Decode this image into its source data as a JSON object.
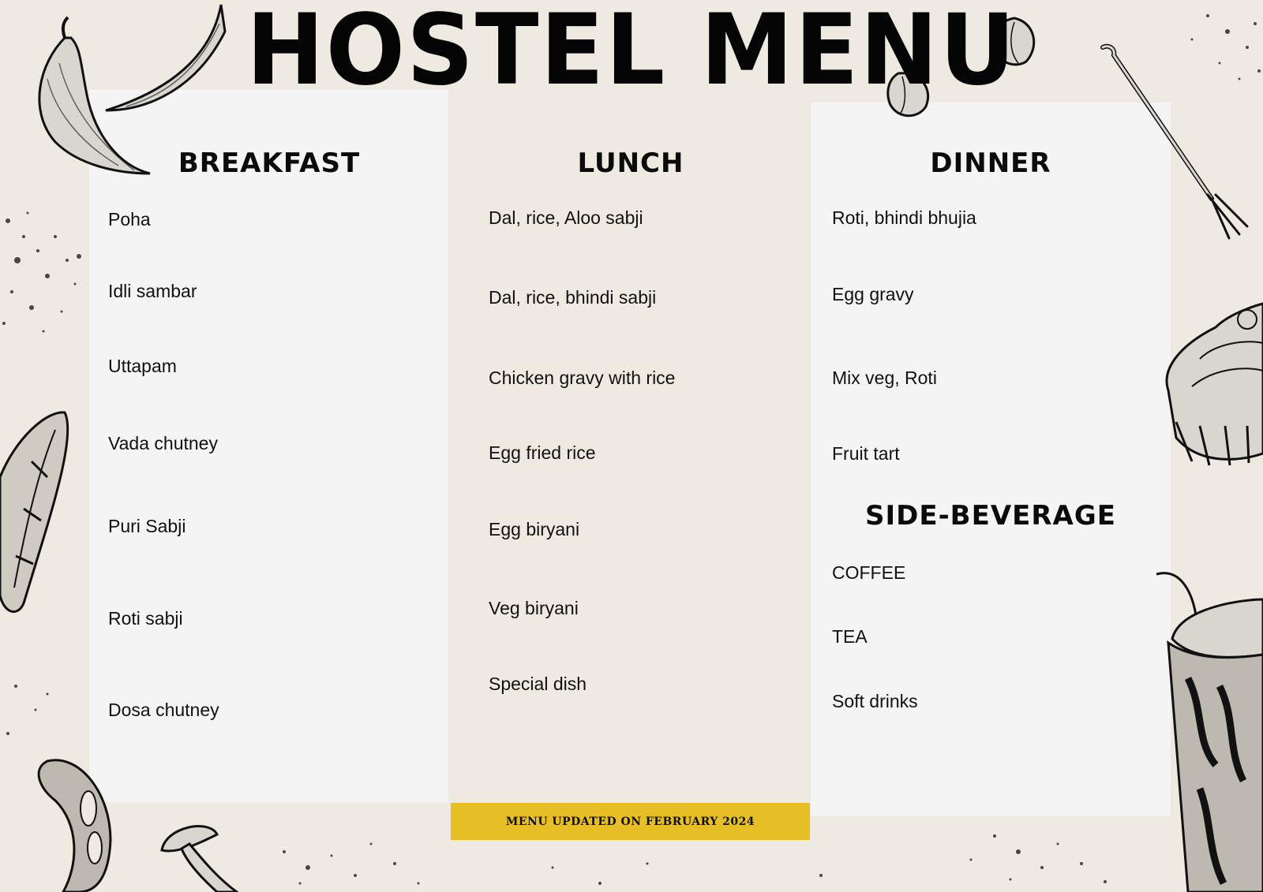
{
  "title": "HOSTEL MENU",
  "sections": {
    "breakfast": {
      "heading": "BREAKFAST",
      "items": [
        "Poha",
        "Idli sambar",
        "Uttapam",
        "Vada chutney",
        "Puri Sabji",
        "Roti sabji",
        "Dosa chutney"
      ]
    },
    "lunch": {
      "heading": "LUNCH",
      "items": [
        "Dal, rice, Aloo sabji",
        "Dal, rice, bhindi sabji",
        "Chicken gravy with rice",
        "Egg fried rice",
        "Egg biryani",
        "Veg biryani",
        "Special dish"
      ]
    },
    "dinner": {
      "heading": "DINNER",
      "items": [
        "Roti, bhindi bhujia",
        "Egg gravy",
        "Mix veg, Roti",
        "Fruit tart"
      ]
    },
    "side_beverage": {
      "heading": "SIDE-BEVERAGE",
      "items": [
        "COFFEE",
        "TEA",
        "Soft drinks"
      ]
    }
  },
  "footer": "MENU UPDATED ON FEBRUARY 2024",
  "colors": {
    "background": "#EEEAE1",
    "panel": "#F4F4F4",
    "accent": "#E6BE26",
    "text": "#111111"
  },
  "decorations": [
    "chili-pepper-illustration",
    "garlic-illustration",
    "fork-illustration",
    "sausage-illustration",
    "cinnamon-roll-illustration",
    "milkshake-illustration",
    "mushroom-illustration",
    "ink-splatter"
  ]
}
